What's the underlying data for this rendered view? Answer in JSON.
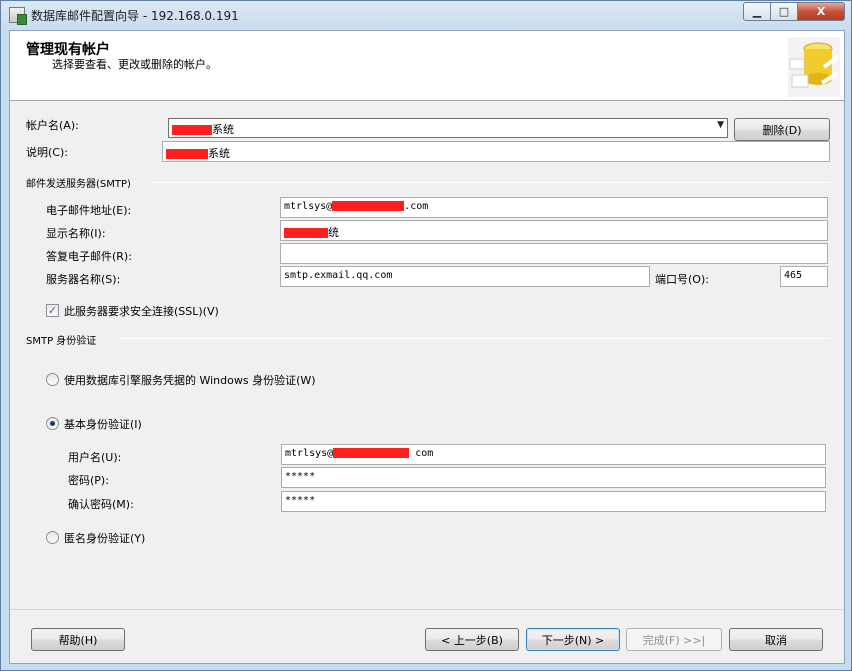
{
  "window": {
    "title": "数据库邮件配置向导 - 192.168.0.191",
    "controls": {
      "minimize": "▁",
      "maximize": "□",
      "close": "X"
    }
  },
  "header": {
    "title": "管理现有帐户",
    "subtitle": "选择要查看、更改或删除的帐户。",
    "graphic": "database-icon"
  },
  "account": {
    "name_label": "帐户名(A):",
    "name_value": "系统",
    "delete_label": "删除(D)",
    "description_label": "说明(C):",
    "description_value": "系统"
  },
  "smtp": {
    "section_title": "邮件发送服务器(SMTP)",
    "email_label": "电子邮件地址(E):",
    "email_prefix": "mtrlsys@",
    "email_suffix": ".com",
    "display_name_label": "显示名称(I):",
    "display_name_value": "统",
    "reply_label": "答复电子邮件(R):",
    "reply_value": "",
    "server_label": "服务器名称(S):",
    "server_value": "smtp.exmail.qq.com",
    "port_label": "端口号(O):",
    "port_value": "465",
    "ssl_label": "此服务器要求安全连接(SSL)(V)",
    "ssl_checked": true
  },
  "auth": {
    "section_title": "SMTP 身份验证",
    "windows_label": "使用数据库引擎服务凭据的 Windows 身份验证(W)",
    "basic_label": "基本身份验证(I)",
    "username_label": "用户名(U):",
    "username_prefix": "mtrlsys@",
    "username_suffix": "com",
    "password_label": "密码(P):",
    "password_value": "*****",
    "confirm_label": "确认密码(M):",
    "confirm_value": "*****",
    "anonymous_label": "匿名身份验证(Y)",
    "selected": "basic"
  },
  "footer": {
    "help": "帮助(H)",
    "back": "< 上一步(B)",
    "next": "下一步(N) >",
    "finish": "完成(F) >>|",
    "cancel": "取消"
  },
  "colors": {
    "redaction": "#ff1f1f",
    "selected_radio": "#1c3a70"
  }
}
